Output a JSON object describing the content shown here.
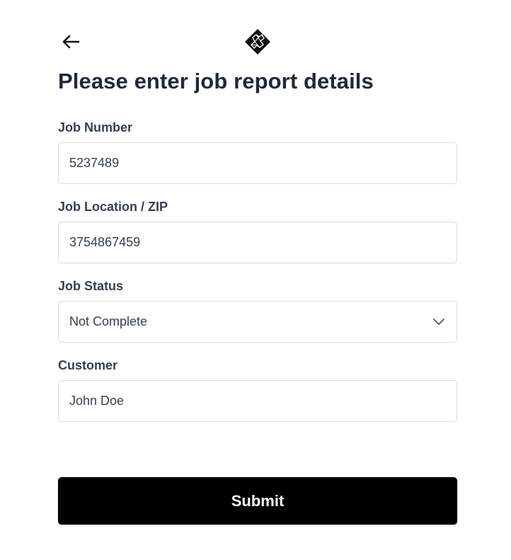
{
  "header": {
    "back_icon": "arrow-left-icon",
    "logo_icon": "diamond-logo-icon"
  },
  "page": {
    "title": "Please enter job report details"
  },
  "form": {
    "job_number": {
      "label": "Job Number",
      "value": "5237489"
    },
    "job_location": {
      "label": "Job Location / ZIP",
      "value": "3754867459"
    },
    "job_status": {
      "label": "Job Status",
      "selected": "Not Complete",
      "icon": "chevron-down-icon"
    },
    "customer": {
      "label": "Customer",
      "value": "John Doe"
    },
    "submit_label": "Submit"
  },
  "colors": {
    "title_text": "#1e293b",
    "label_text": "#334155",
    "field_border": "#d7dce2",
    "button_bg": "#000000",
    "button_text": "#ffffff"
  }
}
